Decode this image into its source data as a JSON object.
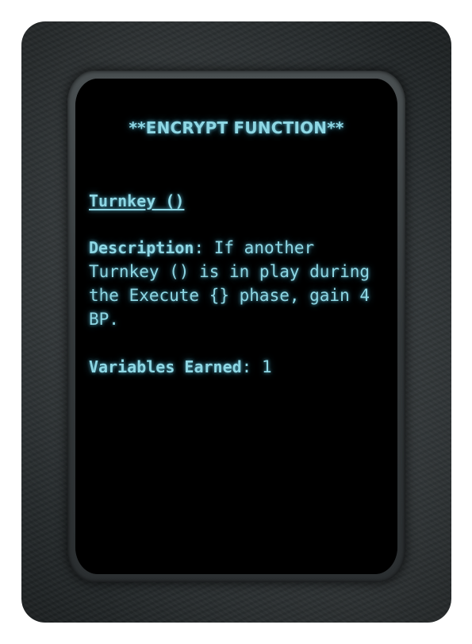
{
  "card": {
    "title": "**ENCRYPT FUNCTION**",
    "function_name": "Turnkey ()",
    "description_label": "Description",
    "description_sep": ": ",
    "description_text": "If another Turnkey () is in play during the Execute {} phase, gain 4 BP.",
    "variables_label": "Variables Earned",
    "variables_sep": ": ",
    "variables_value": "1"
  },
  "colors": {
    "text": "#8ed7e4",
    "screen": "#000000",
    "frame": "#2c3133"
  }
}
